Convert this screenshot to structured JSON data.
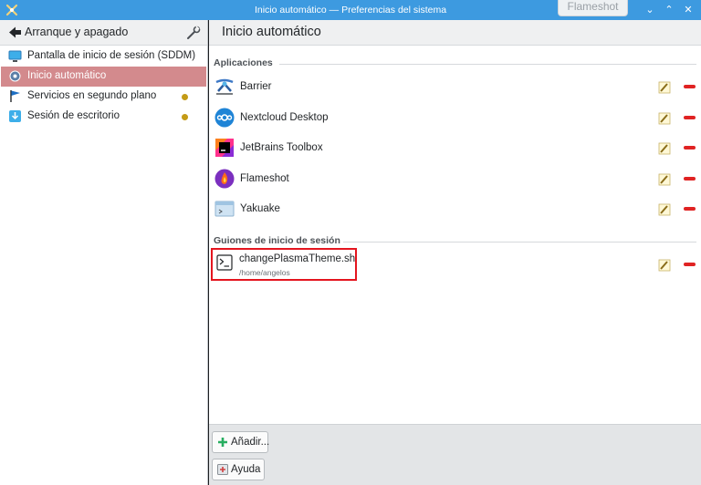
{
  "window": {
    "title": "Inicio automático — Preferencias del sistema",
    "flameshot_tip": "Flameshot",
    "controls": [
      "minimize-icon",
      "maximize-icon",
      "close-icon"
    ]
  },
  "sidebar": {
    "back_title": "Arranque y apagado",
    "items": [
      {
        "label": "Pantalla de inicio de sesión (SDDM)",
        "icon": "monitor-icon",
        "selected": false,
        "dot": false
      },
      {
        "label": "Inicio automático",
        "icon": "gear-icon",
        "selected": true,
        "dot": false
      },
      {
        "label": "Servicios en segundo plano",
        "icon": "flag-icon",
        "selected": false,
        "dot": true
      },
      {
        "label": "Sesión de escritorio",
        "icon": "download-icon",
        "selected": false,
        "dot": true
      }
    ]
  },
  "main": {
    "title": "Inicio automático",
    "applications_header": "Aplicaciones",
    "applications": [
      {
        "name": "Barrier",
        "icon": "barrier-icon"
      },
      {
        "name": "Nextcloud Desktop",
        "icon": "nextcloud-icon"
      },
      {
        "name": "JetBrains Toolbox",
        "icon": "jetbrains-toolbox-icon"
      },
      {
        "name": "Flameshot",
        "icon": "flameshot-icon"
      },
      {
        "name": "Yakuake",
        "icon": "yakuake-icon"
      }
    ],
    "scripts_header": "Guiones de inicio de sesión",
    "scripts": [
      {
        "name": "changePlasmaTheme.sh",
        "path": "/home/angelos",
        "icon": "terminal-icon",
        "highlighted": true
      }
    ]
  },
  "footer": {
    "add_label": "Añadir...",
    "help_label": "Ayuda"
  },
  "colors": {
    "titlebar": "#3d9ae0",
    "selection": "#d38a8d",
    "remove": "#e02323",
    "highlight_box": "#e4151f",
    "status_dot": "#c49b16"
  }
}
